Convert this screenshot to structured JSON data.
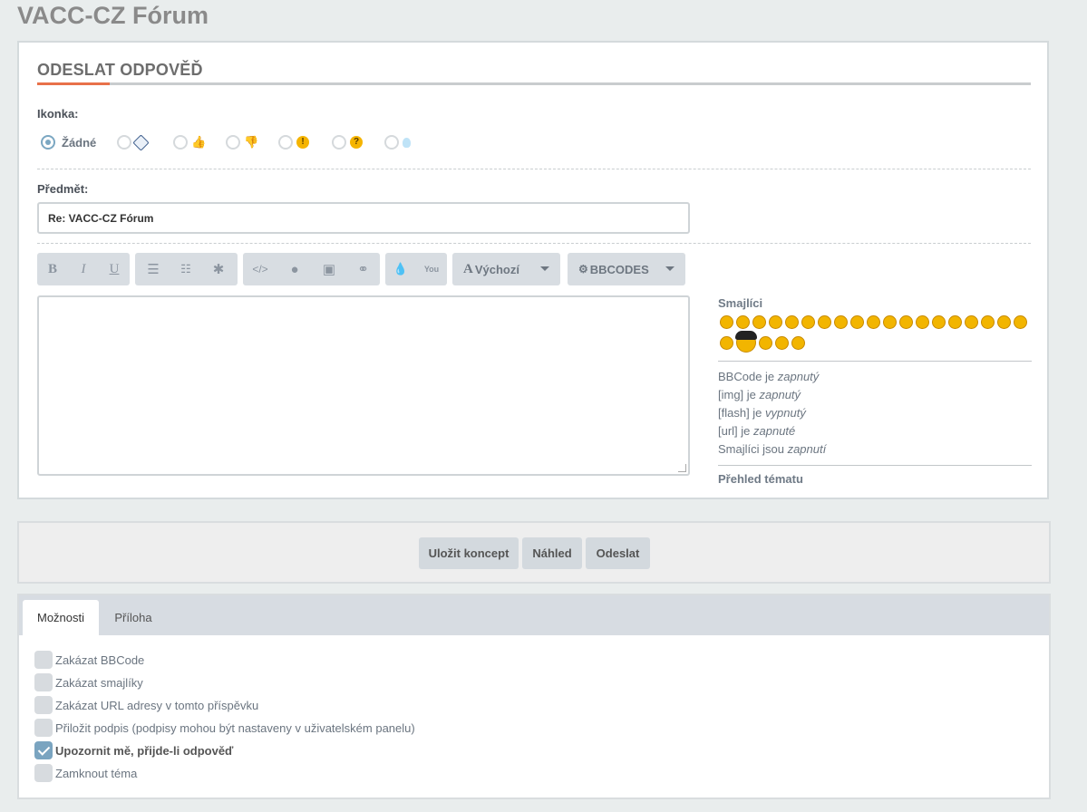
{
  "site": {
    "title": "VACC-CZ Fórum"
  },
  "reply": {
    "heading": "ODESLAT ODPOVĚĎ",
    "icon_label": "Ikonka:",
    "icon_options": [
      {
        "label": "Žádné",
        "icon": "none",
        "checked": true
      },
      {
        "label": "",
        "icon": "tag-icon",
        "checked": false
      },
      {
        "label": "",
        "icon": "thumbs-up-icon",
        "checked": false
      },
      {
        "label": "",
        "icon": "thumbs-down-icon",
        "checked": false
      },
      {
        "label": "",
        "icon": "exclamation-icon",
        "checked": false
      },
      {
        "label": "",
        "icon": "question-icon",
        "checked": false
      },
      {
        "label": "",
        "icon": "lightbulb-icon",
        "checked": false
      }
    ],
    "subject_label": "Předmět:",
    "subject_value": "Re: VACC-CZ Fórum",
    "font_dropdown": "Výchozí",
    "bbcodes_dropdown": "BBCODES",
    "message_value": ""
  },
  "sidebar": {
    "smilies_heading": "Smajlíci",
    "smiley_count": 24,
    "status": [
      {
        "prefix": "BBCode je ",
        "state": "zapnutý"
      },
      {
        "prefix": "[img] je ",
        "state": "zapnutý"
      },
      {
        "prefix": "[flash] je ",
        "state": "vypnutý"
      },
      {
        "prefix": "[url] je ",
        "state": "zapnuté"
      },
      {
        "prefix": "Smajlíci jsou ",
        "state": "zapnutí"
      }
    ],
    "topic_review": "Přehled tématu"
  },
  "actions": {
    "save_draft": "Uložit koncept",
    "preview": "Náhled",
    "submit": "Odeslat"
  },
  "options": {
    "tabs": [
      "Možnosti",
      "Příloha"
    ],
    "checkboxes": [
      {
        "label": "Zakázat BBCode",
        "checked": false
      },
      {
        "label": "Zakázat smajlíky",
        "checked": false
      },
      {
        "label": "Zakázat URL adresy v tomto příspěvku",
        "checked": false
      },
      {
        "label": "Přiložit podpis (podpisy mohou být nastaveny v uživatelském panelu)",
        "checked": false
      },
      {
        "label": "Upozornit mě, přijde-li odpověď",
        "checked": true
      },
      {
        "label": "Zamknout téma",
        "checked": false
      }
    ]
  },
  "colors": {
    "accent": "#e8714a",
    "check": "#7aa4c0",
    "background": "#e9eded"
  }
}
